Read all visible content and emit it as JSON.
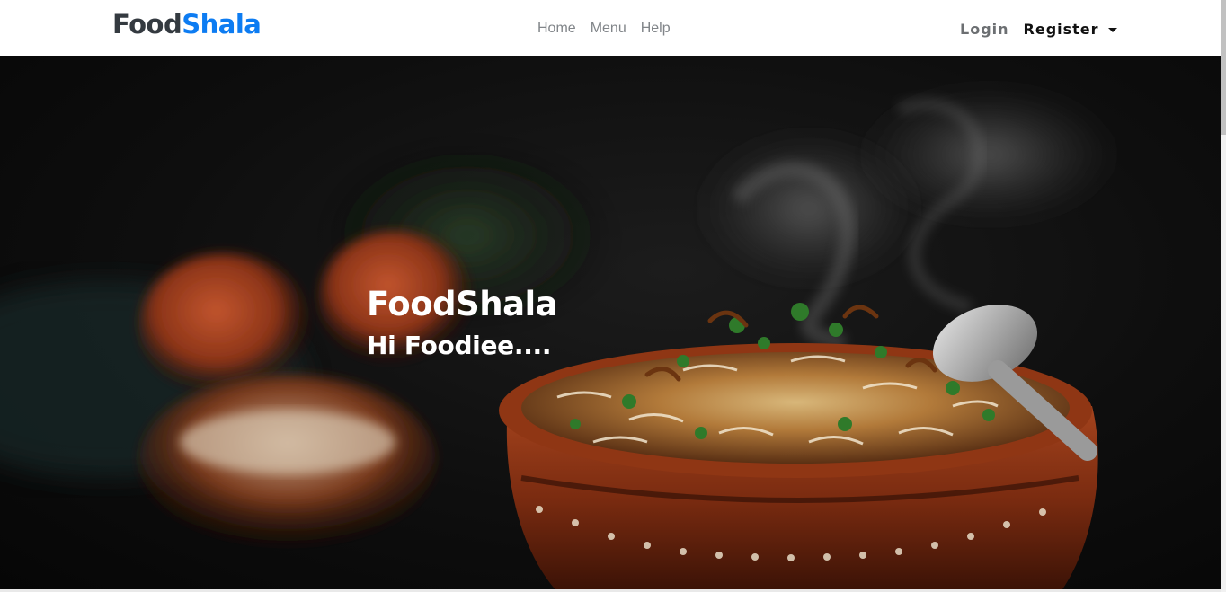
{
  "navbar": {
    "brand_part1": "Food",
    "brand_part2": "Shala",
    "links": [
      "Home",
      "Menu",
      "Help"
    ],
    "login_label": "Login",
    "register_label": "Register"
  },
  "hero": {
    "title": "FoodShala",
    "subtitle": "Hi Foodiee....",
    "image_subject": "biryani-in-clay-pot"
  },
  "colors": {
    "brand_dark": "#343a40",
    "brand_accent": "#0d7cf2",
    "nav_link": "#818589",
    "hero_text": "#ffffff"
  }
}
